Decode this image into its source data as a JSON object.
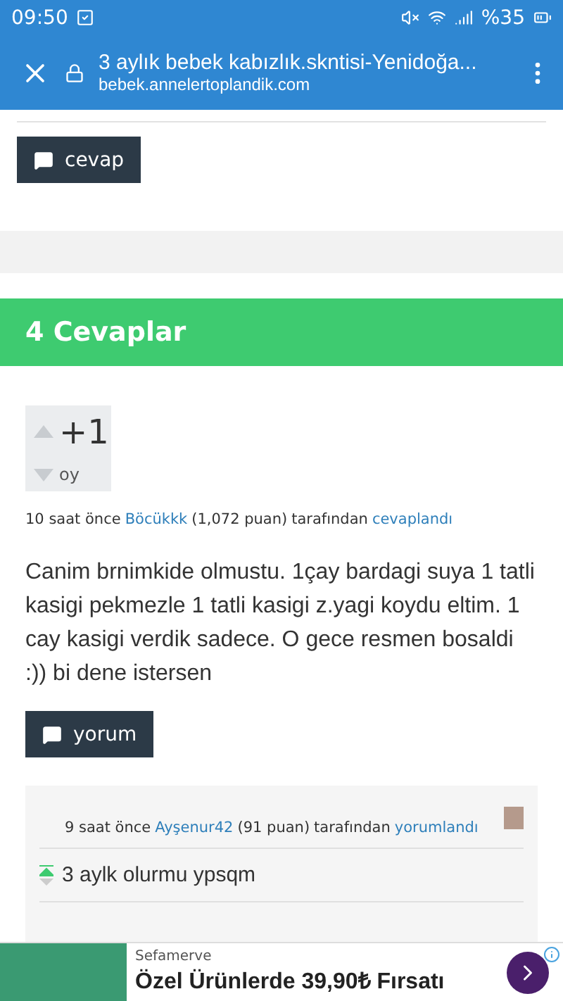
{
  "status_bar": {
    "time": "09:50",
    "battery": "%35"
  },
  "toolbar": {
    "title": "3 aylık bebek kabızlık.skntisi-Yenidoğa...",
    "url": "bebek.annelertoplandik.com"
  },
  "question_actions": {
    "reply_button": "cevap"
  },
  "answers_header": "4 Cevaplar",
  "answer": {
    "votes": "+1",
    "votes_label": "oy",
    "meta": {
      "time": "10 saat önce",
      "user": "Böcükkk",
      "points": "(1,072 puan)",
      "by": "tarafından",
      "action": "cevaplandı"
    },
    "body": "Canim brnimkide olmustu. 1çay bardagi suya 1 tatli kasigi pekmezle 1 tatli kasigi z.yagi koydu eltim. 1 cay kasigi verdik sadece. O gece resmen bosaldi :)) bi dene istersen",
    "comment_button": "yorum"
  },
  "comment": {
    "meta": {
      "time": "9 saat önce",
      "user": "Ayşenur42",
      "points": "(91 puan)",
      "by": "tarafından",
      "action": "yorumlandı"
    },
    "body": "3 aylk olurmu ypsqm"
  },
  "ad": {
    "advertiser": "Sefamerve",
    "headline": "Özel Ürünlerde 39,90₺ Fırsatı"
  }
}
